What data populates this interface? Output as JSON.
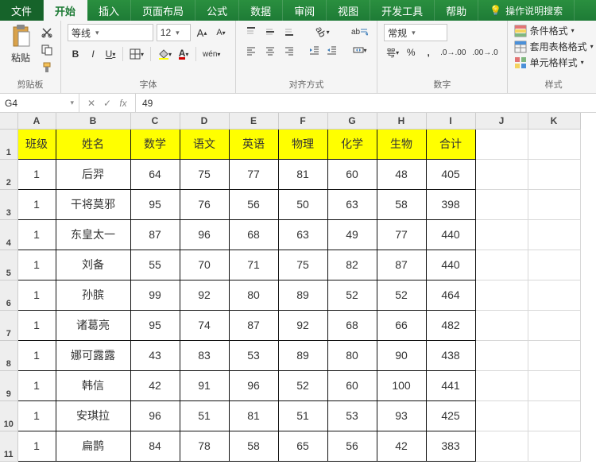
{
  "tabs": {
    "file": "文件",
    "home": "开始",
    "insert": "插入",
    "layout": "页面布局",
    "formulas": "公式",
    "data": "数据",
    "review": "审阅",
    "view": "视图",
    "dev": "开发工具",
    "help": "帮助",
    "tell": "操作说明搜索"
  },
  "ribbon": {
    "clipboard": {
      "paste": "粘贴",
      "label": "剪贴板"
    },
    "font": {
      "name": "等线",
      "size": "12",
      "label": "字体",
      "bold": "B",
      "italic": "I",
      "underline": "U"
    },
    "align": {
      "label": "对齐方式",
      "wrap": "ab",
      "merge": "合并"
    },
    "number": {
      "format": "常规",
      "label": "数字"
    },
    "styles": {
      "cond": "条件格式",
      "table": "套用表格格式",
      "cell": "单元格样式",
      "label": "样式"
    }
  },
  "formula_bar": {
    "name_box": "G4",
    "value": "49"
  },
  "columns": [
    "A",
    "B",
    "C",
    "D",
    "E",
    "F",
    "G",
    "H",
    "I",
    "J",
    "K"
  ],
  "col_widths": [
    "colA",
    "colB",
    "colCtoI",
    "colCtoI",
    "colCtoI",
    "colCtoI",
    "colCtoI",
    "colCtoI",
    "colCtoI",
    "colJK",
    "colJK"
  ],
  "header_row": [
    "班级",
    "姓名",
    "数学",
    "语文",
    "英语",
    "物理",
    "化学",
    "生物",
    "合计"
  ],
  "rows": [
    [
      "1",
      "后羿",
      "64",
      "75",
      "77",
      "81",
      "60",
      "48",
      "405"
    ],
    [
      "1",
      "干将莫邪",
      "95",
      "76",
      "56",
      "50",
      "63",
      "58",
      "398"
    ],
    [
      "1",
      "东皇太一",
      "87",
      "96",
      "68",
      "63",
      "49",
      "77",
      "440"
    ],
    [
      "1",
      "刘备",
      "55",
      "70",
      "71",
      "75",
      "82",
      "87",
      "440"
    ],
    [
      "1",
      "孙膑",
      "99",
      "92",
      "80",
      "89",
      "52",
      "52",
      "464"
    ],
    [
      "1",
      "诸葛亮",
      "95",
      "74",
      "87",
      "92",
      "68",
      "66",
      "482"
    ],
    [
      "1",
      "娜可露露",
      "43",
      "83",
      "53",
      "89",
      "80",
      "90",
      "438"
    ],
    [
      "1",
      "韩信",
      "42",
      "91",
      "96",
      "52",
      "60",
      "100",
      "441"
    ],
    [
      "1",
      "安琪拉",
      "96",
      "51",
      "81",
      "51",
      "53",
      "93",
      "425"
    ],
    [
      "1",
      "扁鹊",
      "84",
      "78",
      "58",
      "65",
      "56",
      "42",
      "383"
    ]
  ]
}
